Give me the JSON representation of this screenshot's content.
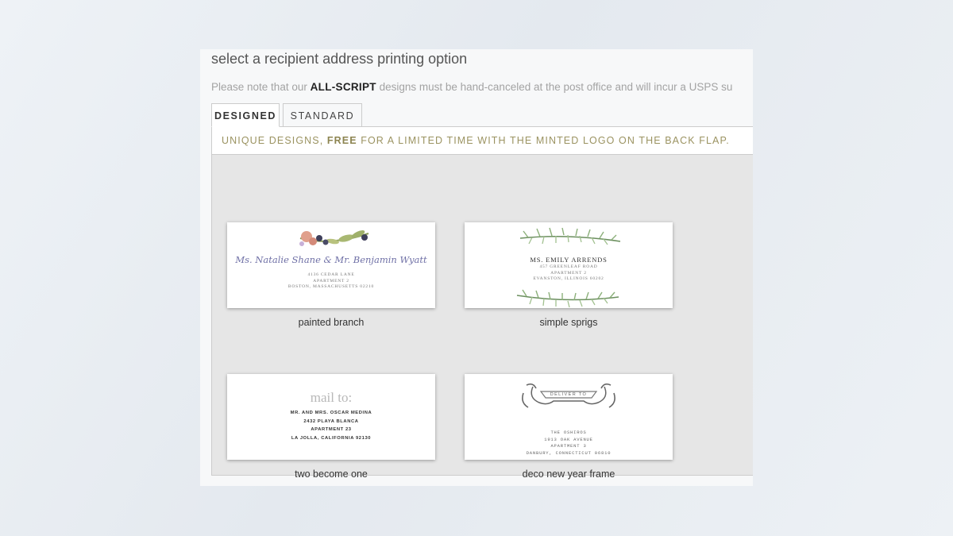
{
  "header": {
    "title": "select a recipient address printing option",
    "note_prefix": "Please note that our ",
    "note_bold": "ALL-SCRIPT",
    "note_suffix": " designs must be hand-canceled at the post office and will incur a USPS su"
  },
  "tabs": [
    {
      "label": "DESIGNED",
      "active": true
    },
    {
      "label": "STANDARD",
      "active": false
    }
  ],
  "promo": {
    "part1": "UNIQUE DESIGNS, ",
    "bold": "FREE",
    "part2": " FOR A LIMITED TIME WITH THE MINTED LOGO ON THE BACK FLAP."
  },
  "designs": [
    {
      "caption": "painted branch",
      "name_line": "Ms. Natalie Shane & Mr. Benjamin Wyatt",
      "lines": [
        "4136 CEDAR LANE",
        "APARTMENT 2",
        "BOSTON, MASSACHUSETTS 02210"
      ]
    },
    {
      "caption": "simple sprigs",
      "name_line": "MS. EMILY ARRENDS",
      "lines": [
        "457 GREENLEAF ROAD",
        "APARTMENT 2",
        "EVANSTON, ILLINOIS 60202"
      ]
    },
    {
      "caption": "two become one",
      "heading": "mail to:",
      "lines": [
        "MR. AND MRS. OSCAR MEDINA",
        "2432 PLAYA BLANCA",
        "APARTMENT 23",
        "LA JOLLA, CALIFORNIA 92130"
      ]
    },
    {
      "caption": "deco new year frame",
      "banner": "DELIVER TO",
      "lines": [
        "THE OSHIROS",
        "1913 OAK AVENUE",
        "APARTMENT 3",
        "DANBURY, CONNECTICUT 06810"
      ]
    }
  ],
  "colors": {
    "promo_text": "#9b9361",
    "script_ink": "#6f70a6",
    "leaf_green": "#7fa36a",
    "panel_bg": "#e6e6e6"
  }
}
